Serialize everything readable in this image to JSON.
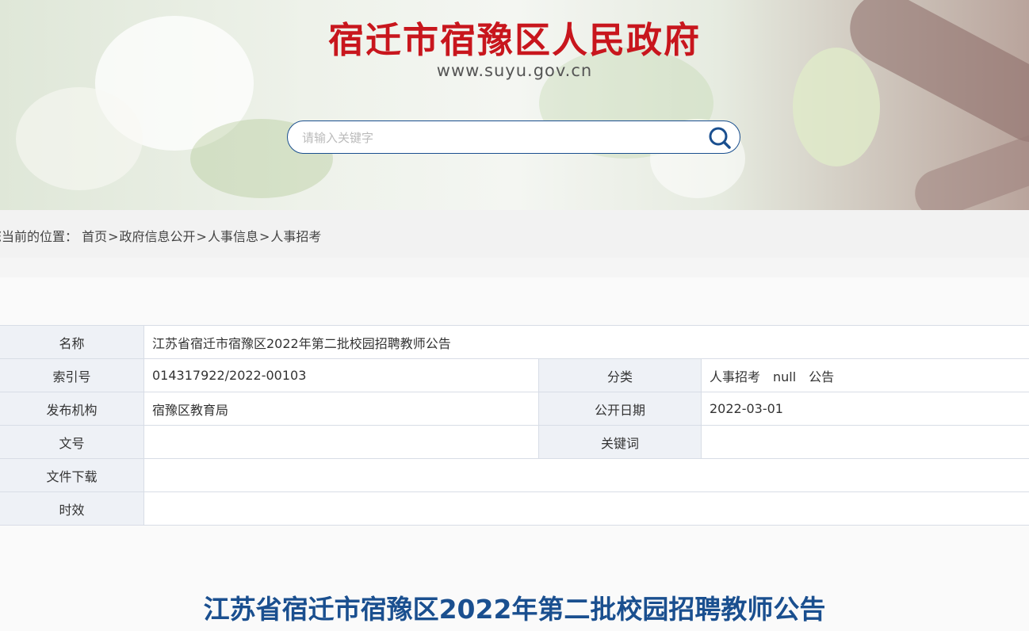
{
  "header": {
    "site_title": "宿迁市宿豫区人民政府",
    "site_url": "www.suyu.gov.cn"
  },
  "search": {
    "placeholder": "请输入关键字",
    "value": ""
  },
  "breadcrumb": {
    "prefix": "您当前的位置：",
    "items": [
      "首页",
      "政府信息公开",
      "人事信息",
      "人事招考"
    ],
    "separator": ">"
  },
  "meta": {
    "name_label": "名称",
    "name_value": "江苏省宿迁市宿豫区2022年第二批校园招聘教师公告",
    "index_label": "索引号",
    "index_value": "014317922/2022-00103",
    "category_label": "分类",
    "category_value": "人事招考　null　公告",
    "publisher_label": "发布机构",
    "publisher_value": "宿豫区教育局",
    "date_label": "公开日期",
    "date_value": "2022-03-01",
    "docno_label": "文号",
    "docno_value": "",
    "keywords_label": "关键词",
    "keywords_value": "",
    "download_label": "文件下载",
    "download_value": "",
    "validity_label": "时效",
    "validity_value": ""
  },
  "article": {
    "title": "江苏省宿迁市宿豫区2022年第二批校园招聘教师公告"
  },
  "colors": {
    "title_red": "#c8161d",
    "accent_blue": "#1a4f8f",
    "label_bg": "#eef1f6"
  }
}
